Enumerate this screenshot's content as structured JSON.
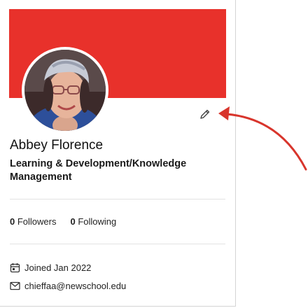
{
  "profile": {
    "name": "Abbey Florence",
    "title": "Learning & Development/Knowledge Management",
    "followers_count": "0",
    "followers_label": "Followers",
    "following_count": "0",
    "following_label": "Following",
    "joined": "Joined Jan 2022",
    "email": "chieffaa@newschool.edu"
  },
  "colors": {
    "cover": "#e8312b",
    "annotation_arrow": "#d8352c"
  },
  "icons": {
    "edit": "pencil-icon",
    "joined": "calendar-icon",
    "email": "envelope-icon"
  }
}
